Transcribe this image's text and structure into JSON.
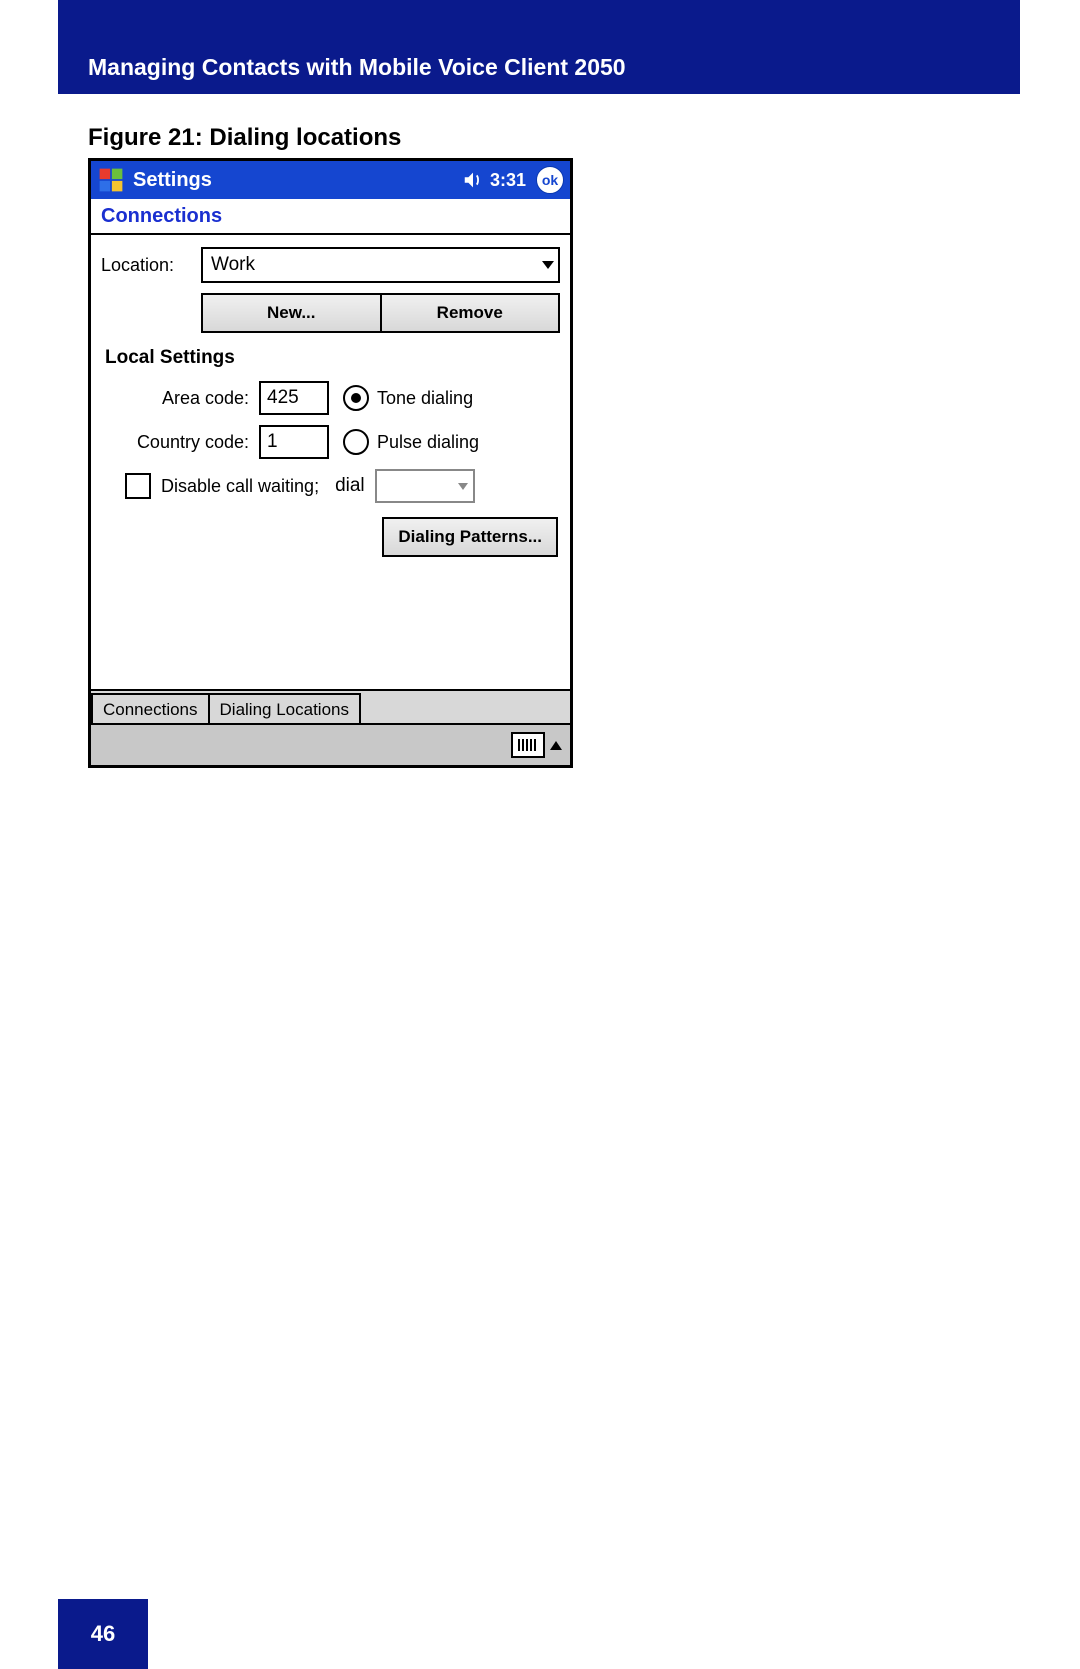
{
  "doc": {
    "header": "Managing Contacts with Mobile Voice Client 2050",
    "figure_caption": "Figure 21: Dialing locations",
    "page_number": "46"
  },
  "titlebar": {
    "app": "Settings",
    "time": "3:31",
    "ok": "ok"
  },
  "subheader": "Connections",
  "location": {
    "label": "Location:",
    "value": "Work"
  },
  "buttons": {
    "new": "New...",
    "remove": "Remove",
    "dialing_patterns": "Dialing Patterns..."
  },
  "local_settings": {
    "title": "Local Settings",
    "area_code_label": "Area code:",
    "area_code_value": "425",
    "country_code_label": "Country code:",
    "country_code_value": "1",
    "tone_label": "Tone dialing",
    "pulse_label": "Pulse dialing",
    "tone_selected": true,
    "disable_cw_label": "Disable call waiting;",
    "dial_label": "dial"
  },
  "tabs": {
    "connections": "Connections",
    "dialing_locations": "Dialing Locations"
  }
}
